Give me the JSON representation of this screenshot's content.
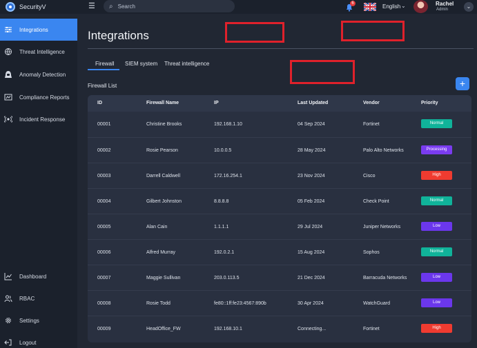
{
  "app": {
    "name": "SecurityV"
  },
  "search": {
    "placeholder": "Search"
  },
  "notifications": {
    "count": "6"
  },
  "language": {
    "label": "English"
  },
  "user": {
    "name": "Rachel",
    "role": "Admin"
  },
  "sidebar": {
    "items": [
      {
        "label": "Integrations",
        "icon": "sliders-icon",
        "active": true
      },
      {
        "label": "Threat Intelligence",
        "icon": "globe-shield-icon"
      },
      {
        "label": "Anomaly Detection",
        "icon": "hood-icon"
      },
      {
        "label": "Compliance Reports",
        "icon": "report-icon"
      },
      {
        "label": "Incident Response",
        "icon": "broadcast-icon"
      }
    ],
    "bottom_items": [
      {
        "label": "Dashboard",
        "icon": "trend-icon"
      },
      {
        "label": "RBAC",
        "icon": "users-icon"
      },
      {
        "label": "Settings",
        "icon": "gear-icon"
      },
      {
        "label": "Logout",
        "icon": "logout-icon"
      }
    ]
  },
  "main": {
    "title": "Integrations",
    "tabs": [
      {
        "label": "Firewall",
        "active": true
      },
      {
        "label": "SIEM system"
      },
      {
        "label": "Threat intelligence"
      }
    ],
    "section_label": "Firewall List",
    "add_label": "+"
  },
  "table": {
    "columns": [
      "ID",
      "Firewall Name",
      "IP",
      "Last Updated",
      "Vendor",
      "Priority"
    ],
    "rows": [
      {
        "id": "00001",
        "name": "Christine Brooks",
        "ip": "192.168.1.10",
        "updated": "04 Sep 2024",
        "vendor": "Fortinet",
        "priority": "Normal"
      },
      {
        "id": "00002",
        "name": "Rosie Pearson",
        "ip": "10.0.0.5",
        "updated": "28 May 2024",
        "vendor": "Palo Alto Networks",
        "priority": "Processing"
      },
      {
        "id": "00003",
        "name": "Darrell Caldwell",
        "ip": "172.16.254.1",
        "updated": "23 Nov 2024",
        "vendor": "Cisco",
        "priority": "High"
      },
      {
        "id": "00004",
        "name": "Gilbert Johnston",
        "ip": "8.8.8.8",
        "updated": "05 Feb 2024",
        "vendor": "Check Point",
        "priority": "Normal"
      },
      {
        "id": "00005",
        "name": "Alan Cain",
        "ip": "1.1.1.1",
        "updated": "29 Jul 2024",
        "vendor": "Juniper Networks",
        "priority": "Low"
      },
      {
        "id": "00006",
        "name": "Alfred Murray",
        "ip": "192.0.2.1",
        "updated": "15 Aug 2024",
        "vendor": "Sophos",
        "priority": "Normal"
      },
      {
        "id": "00007",
        "name": "Maggie Sullivan",
        "ip": "203.0.113.5",
        "updated": "21 Dec 2024",
        "vendor": "Barracuda Networks",
        "priority": "Low"
      },
      {
        "id": "00008",
        "name": "Rosie Todd",
        "ip": "fe80::1ff:fe23:4567:890b",
        "updated": "30 Apr 2024",
        "vendor": "WatchGuard",
        "priority": "Low"
      },
      {
        "id": "00009",
        "name": "HeadOffice_FW",
        "ip": "192.168.10.1",
        "updated": "Connecting...",
        "vendor": "Fortinet",
        "priority": "High"
      }
    ]
  },
  "priority_colors": {
    "Normal": "#10b39a",
    "Processing": "#7a3cf0",
    "High": "#ef3b30",
    "Low": "#6b37ec"
  },
  "colors": {
    "accent": "#3a86f0",
    "annotation": "#e0212b"
  }
}
